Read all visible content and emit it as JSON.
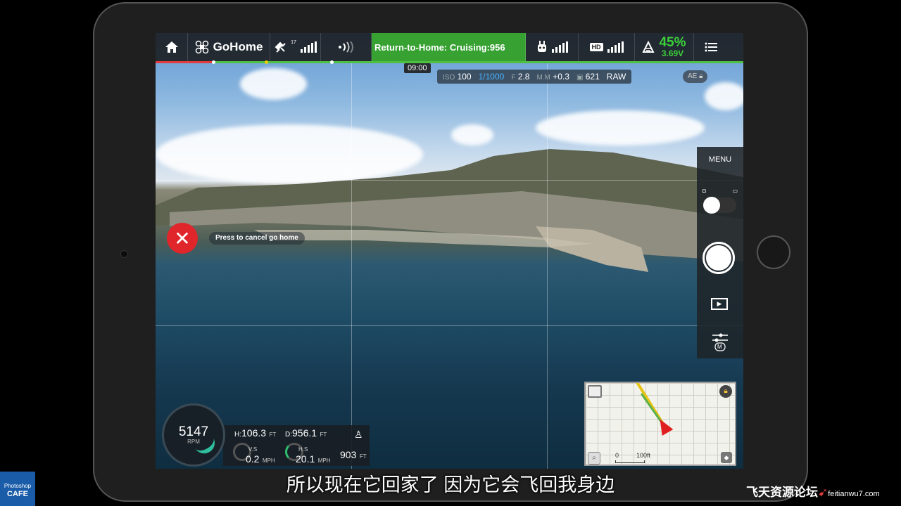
{
  "topbar": {
    "app_mode": "GoHome",
    "rth_status": "Return-to-Home: Cruising:956",
    "gps_count": "17",
    "hd_label": "HD",
    "battery_percent": "45%",
    "battery_voltage": "3.69V"
  },
  "flight_time": "09:00",
  "camera": {
    "iso_label": "ISO",
    "iso": "100",
    "shutter": "1/1000",
    "aperture_label": "F",
    "aperture": "2.8",
    "ev_label": "M.M",
    "ev": "+0.3",
    "remaining_shots": "621",
    "format": "RAW",
    "ae_lock": "AE"
  },
  "cancel": {
    "tooltip": "Press to cancel go home"
  },
  "right_panel": {
    "menu_label": "MENU",
    "mode_label": "M"
  },
  "telemetry": {
    "rpm_value": "5147",
    "rpm_unit": "RPM",
    "h_label": "H:",
    "h_value": "106.3",
    "h_unit": "FT",
    "d_label": "D:",
    "d_value": "956.1",
    "d_unit": "FT",
    "vs_label": "V.S",
    "vs_value": "0.2",
    "vs_unit": "MPH",
    "hs_label": "H.S",
    "hs_value": "20.1",
    "hs_unit": "MPH",
    "alt_value": "903",
    "alt_unit": "FT"
  },
  "minimap": {
    "scale_zero": "0",
    "scale_length": "100ft"
  },
  "subtitle": "所以现在它回家了  因为它会飞回我身边",
  "logo": {
    "line1": "Photoshop",
    "line2": "CAFE"
  },
  "watermark": {
    "text": "飞天资源论坛",
    "site": "feitianwu7.com"
  },
  "colors": {
    "rth_green": "#37a132",
    "battery_green": "#3bd13b",
    "cancel_red": "#e0262a",
    "shutter_blue": "#44b4ff"
  }
}
